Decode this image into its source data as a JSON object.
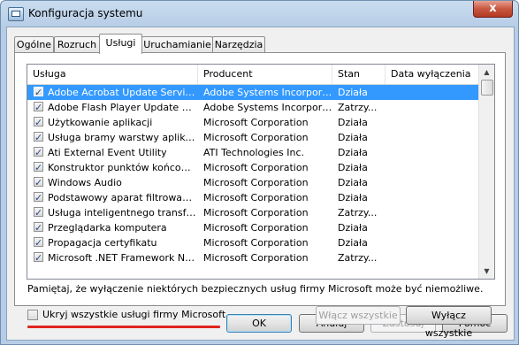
{
  "window": {
    "title": "Konfiguracja systemu",
    "close": "x"
  },
  "tabs": [
    "Ogólne",
    "Rozruch",
    "Usługi",
    "Uruchamianie",
    "Narzędzia"
  ],
  "columns": [
    "Usługa",
    "Producent",
    "Stan",
    "Data wyłączenia"
  ],
  "services": [
    {
      "name": "Adobe Acrobat Update Service",
      "vendor": "Adobe Systems Incorporated",
      "status": "Działa",
      "checked": true,
      "selected": true
    },
    {
      "name": "Adobe Flash Player Update Service",
      "vendor": "Adobe Systems Incorporated",
      "status": "Zatrzy...",
      "checked": true
    },
    {
      "name": "Użytkowanie aplikacji",
      "vendor": "Microsoft Corporation",
      "status": "Działa",
      "checked": true
    },
    {
      "name": "Usługa bramy warstwy aplikacji",
      "vendor": "Microsoft Corporation",
      "status": "Działa",
      "checked": true
    },
    {
      "name": "Ati External Event Utility",
      "vendor": "ATI Technologies Inc.",
      "status": "Działa",
      "checked": true
    },
    {
      "name": "Konstruktor punktów końcowych...",
      "vendor": "Microsoft Corporation",
      "status": "Działa",
      "checked": true
    },
    {
      "name": "Windows Audio",
      "vendor": "Microsoft Corporation",
      "status": "Działa",
      "checked": true
    },
    {
      "name": "Podstawowy aparat filtrowania",
      "vendor": "Microsoft Corporation",
      "status": "Działa",
      "checked": true
    },
    {
      "name": "Usługa inteligentnego transferu ...",
      "vendor": "Microsoft Corporation",
      "status": "Zatrzy...",
      "checked": true
    },
    {
      "name": "Przeglądarka komputera",
      "vendor": "Microsoft Corporation",
      "status": "Działa",
      "checked": true
    },
    {
      "name": "Propagacja certyfikatu",
      "vendor": "Microsoft Corporation",
      "status": "Działa",
      "checked": true
    },
    {
      "name": "Microsoft .NET Framework NGEN...",
      "vendor": "Microsoft Corporation",
      "status": "Zatrzy...",
      "checked": true
    }
  ],
  "note": "Pamiętaj, że wyłączenie niektórych bezpiecznych usług firmy Microsoft może być niemożliwe.",
  "hide_ms_label": "Ukryj wszystkie usługi firmy Microsoft",
  "enable_all": "Włącz wszystkie",
  "disable_all": "Wyłącz wszystkie",
  "buttons": {
    "ok": "OK",
    "cancel": "Anuluj",
    "apply": "Zastosuj",
    "help": "Pomoc"
  }
}
